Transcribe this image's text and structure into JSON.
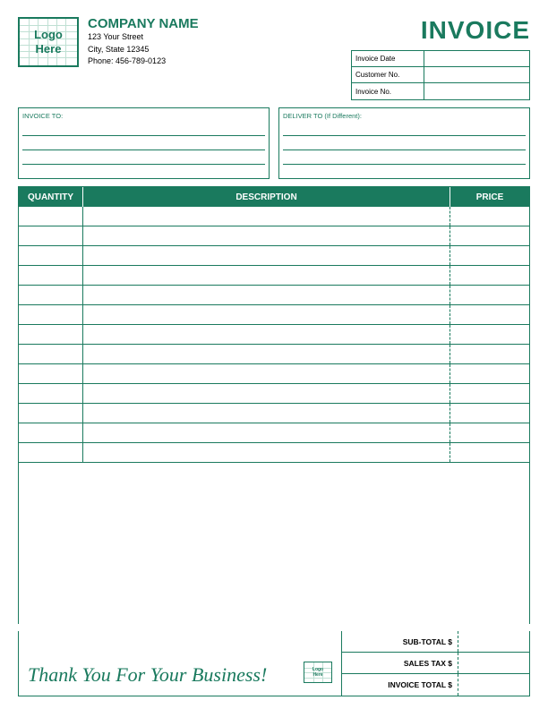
{
  "company": {
    "logo_text_line1": "Logo",
    "logo_text_line2": "Here",
    "name": "COMPANY NAME",
    "street": "123 Your Street",
    "city_state": "City, State 12345",
    "phone": "Phone: 456-789-0123"
  },
  "invoice_header": {
    "title": "INVOICE",
    "fields": [
      {
        "label": "Invoice Date"
      },
      {
        "label": "Customer No."
      },
      {
        "label": "Invoice No."
      }
    ]
  },
  "address_boxes": {
    "invoice_to_label": "INVOICE TO:",
    "deliver_to_label": "DELIVER TO (If Different):"
  },
  "table": {
    "col_qty": "QUANTITY",
    "col_desc": "DESCRIPTION",
    "col_price": "PRICE",
    "rows": 13
  },
  "totals": {
    "sub_total_label": "SUB-TOTAL $",
    "sales_tax_label": "SALES TAX $",
    "invoice_total_label": "INVOICE TOTAL $"
  },
  "footer": {
    "thank_you": "Thank You For Your Business!"
  }
}
